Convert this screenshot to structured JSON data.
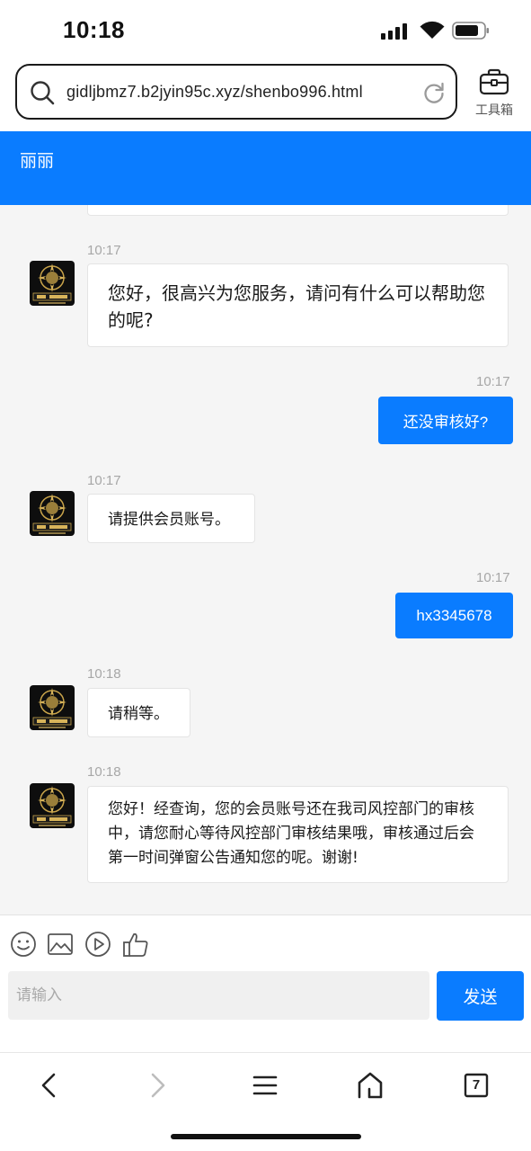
{
  "status_bar": {
    "time": "10:18"
  },
  "browser": {
    "url": "gidljbmz7.b2jyin95c.xyz/shenbo996.html",
    "toolbox_label": "工具箱",
    "tab_count": "7"
  },
  "chat": {
    "title": "丽丽",
    "messages": [
      {
        "from": "agent",
        "time": "10:17",
        "text": "您好，很高兴为您服务，请问有什么可以帮助您的呢?"
      },
      {
        "from": "user",
        "time": "10:17",
        "text": "还没审核好?"
      },
      {
        "from": "agent",
        "time": "10:17",
        "text": "请提供会员账号。"
      },
      {
        "from": "user",
        "time": "10:17",
        "text": "hx3345678"
      },
      {
        "from": "agent",
        "time": "10:18",
        "text": "请稍等。"
      },
      {
        "from": "agent",
        "time": "10:18",
        "text": "您好！经查询，您的会员账号还在我司风控部门的审核中，请您耐心等待风控部门审核结果哦，审核通过后会第一时间弹窗公告通知您的呢。谢谢!"
      }
    ]
  },
  "input": {
    "placeholder": "请输入",
    "send_label": "发送"
  },
  "colors": {
    "accent": "#0a7cff",
    "chat_bg": "#f5f5f5"
  },
  "icons": [
    "search-icon",
    "reload-icon",
    "toolbox-icon",
    "emoji-icon",
    "image-icon",
    "video-icon",
    "thumbs-up-icon",
    "back-icon",
    "forward-icon",
    "menu-icon",
    "home-icon",
    "tabs-icon"
  ]
}
